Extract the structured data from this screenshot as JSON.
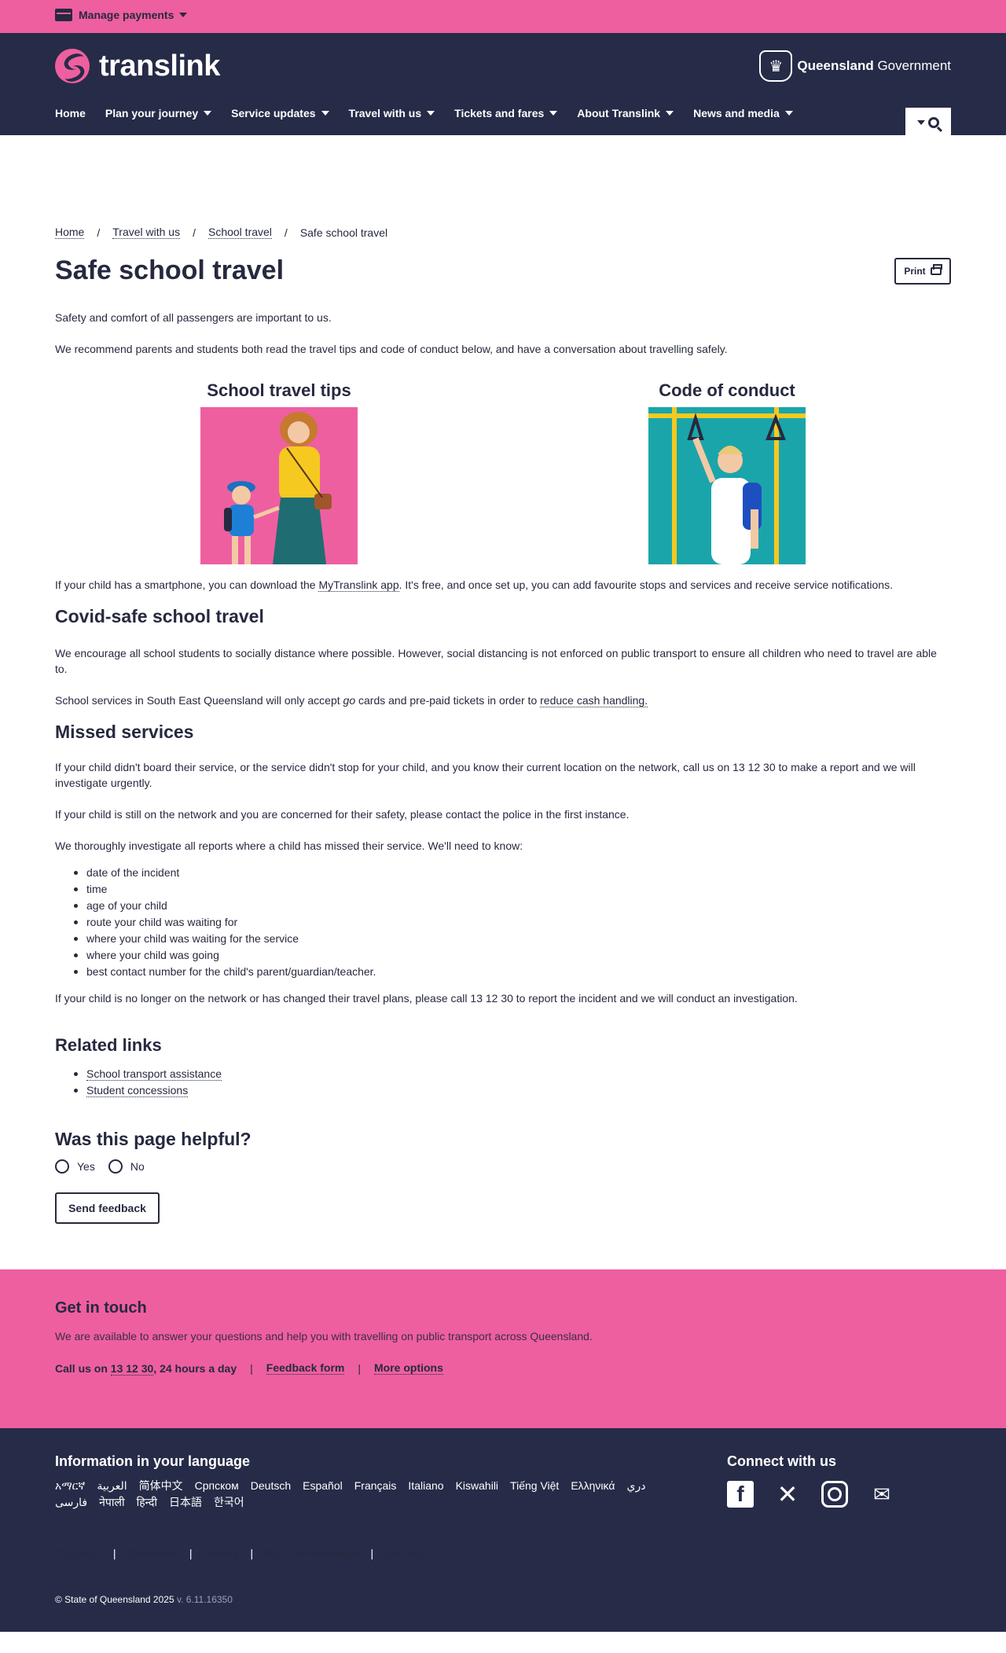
{
  "topbar": {
    "manage_payments": "Manage payments"
  },
  "header": {
    "logo_text": "translink",
    "qgov_bold": "Queensland",
    "qgov_rest": " Government",
    "nav": [
      {
        "label": "Home"
      },
      {
        "label": "Plan your journey"
      },
      {
        "label": "Service updates"
      },
      {
        "label": "Travel with us"
      },
      {
        "label": "Tickets and fares"
      },
      {
        "label": "About Translink"
      },
      {
        "label": "News and media"
      }
    ]
  },
  "breadcrumb": [
    "Home",
    "Travel with us",
    "School travel",
    "Safe school travel"
  ],
  "page": {
    "title": "Safe school travel",
    "print": "Print",
    "intro1": "Safety and comfort of all passengers are important to us.",
    "intro2": "We recommend parents and students both read the travel tips and code of conduct below, and have a conversation about travelling safely.",
    "card1_title": "School travel tips",
    "card2_title": "Code of conduct",
    "app_pre": "If your child has a smartphone, you can download the ",
    "app_link": "MyTranslink app",
    "app_post": ". It's free, and once set up, you can add favourite stops and services and receive service notifications.",
    "covid_title": "Covid-safe school travel",
    "covid_p1": "We encourage all school students to socially distance where possible. However, social distancing is not enforced on public transport to ensure all children who need to travel are able to.",
    "covid_p2_pre": "School services in South East Queensland will only accept ",
    "covid_p2_go": "go",
    "covid_p2_mid": " cards and pre-paid tickets in order to ",
    "covid_p2_link": "reduce cash handling.",
    "missed_title": "Missed services",
    "missed_p1": "If your child didn't board their service, or the service didn't stop for your child, and you know their current location on the network, call us on 13 12 30 to make a report and we will investigate urgently.",
    "missed_p2": "If your child is still on the network and you are concerned for their safety, please contact the police in the first instance.",
    "missed_p3": "We thoroughly investigate all reports where a child has missed their service. We'll need to know:",
    "missed_list": [
      "date of the incident",
      "time",
      "age of your child",
      "route your child was waiting for",
      "where your child was waiting for the service",
      "where your child was going",
      "best contact number for the child's parent/guardian/teacher."
    ],
    "missed_p4": "If your child is no longer on the network or has changed their travel plans, please call 13 12 30 to report the incident and we will conduct an investigation.",
    "related_title": "Related links",
    "related_links": [
      "School transport assistance",
      "Student concessions"
    ],
    "helpful_title": "Was this page helpful?",
    "yes": "Yes",
    "no": "No",
    "send_feedback": "Send feedback"
  },
  "touch": {
    "title": "Get in touch",
    "text": "We are available to answer your questions and help you with travelling on public transport across Queensland.",
    "call_pre": "Call us on ",
    "call_number": "13 12 30",
    "call_post": ", 24 hours a day",
    "feedback": "Feedback form",
    "more": "More options"
  },
  "footer": {
    "lang_title": "Information in your language",
    "languages": [
      "አማርኛ",
      "العربية",
      "简体中文",
      "Српском",
      "Deutsch",
      "Español",
      "Français",
      "Italiano",
      "Kiswahili",
      "Tiếng Việt",
      "Ελληνικά",
      "دري",
      "فارسی",
      "नेपाली",
      "हिन्दी",
      "日本語",
      "한국어"
    ],
    "connect_title": "Connect with us",
    "social_icons": [
      "facebook-icon",
      "x-icon",
      "instagram-icon",
      "email-icon"
    ],
    "links": [
      "Copyright",
      "Disclaimer",
      "Privacy",
      "Right to information",
      "Site map"
    ],
    "copyright": "© State of Queensland 2025",
    "version": " v. 6.11.16350"
  },
  "colors": {
    "pink": "#ee5fa0",
    "navy": "#262b47",
    "teal": "#1aa5ab"
  }
}
